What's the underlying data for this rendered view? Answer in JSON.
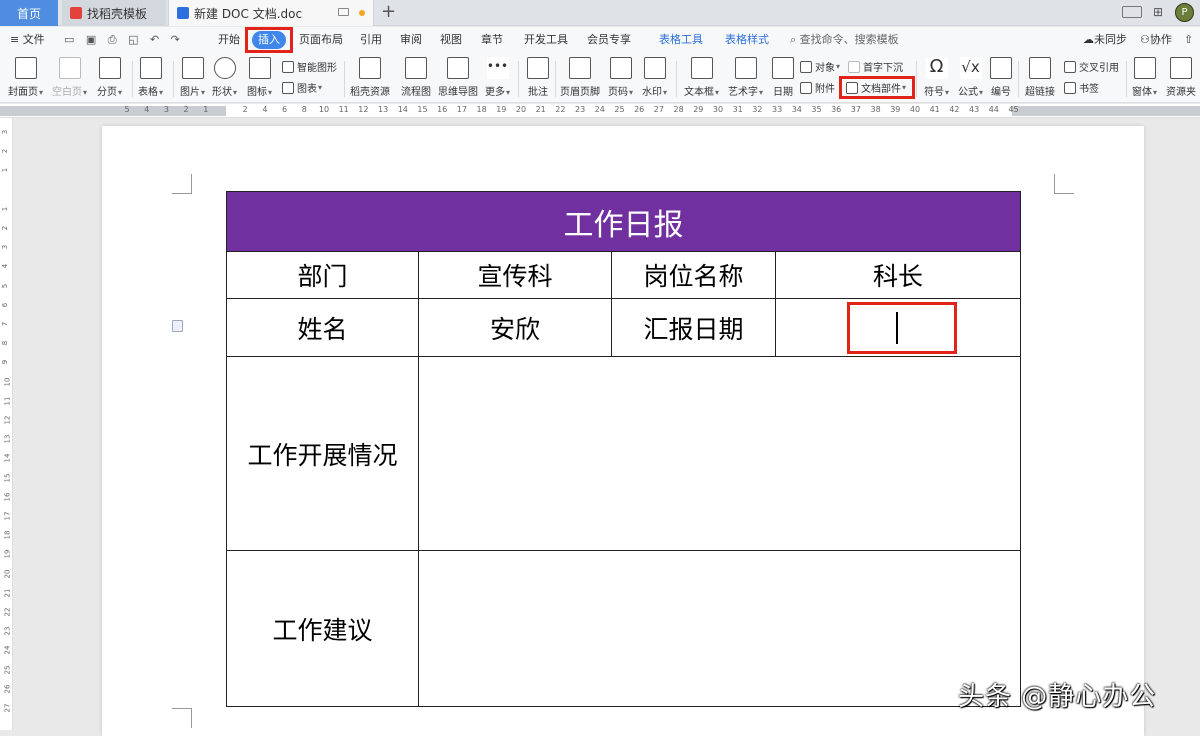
{
  "tabs": {
    "home": "首页",
    "template": "找稻壳模板",
    "document": "新建 DOC 文档.doc",
    "new_tab": "+"
  },
  "window_controls": {
    "layout": "□",
    "grid": "⊞",
    "avatar": "P"
  },
  "menu": {
    "file": "文件",
    "start": "开始",
    "insert": "插入",
    "page_layout": "页面布局",
    "references": "引用",
    "review": "审阅",
    "view": "视图",
    "chapter": "章节",
    "dev_tools": "开发工具",
    "member": "会员专享",
    "table_tools": "表格工具",
    "table_style": "表格样式",
    "search_placeholder": "查找命令、搜索模板",
    "not_synced": "未同步",
    "collaborate": "协作"
  },
  "ribbon": {
    "cover": "封面页",
    "blank_page": "空白页",
    "page_break": "分页",
    "table": "表格",
    "picture": "图片",
    "shape": "形状",
    "icon": "图标",
    "smart_shape": "智能图形",
    "chart": "图表",
    "docer_resources": "稻壳资源",
    "flowchart": "流程图",
    "mindmap": "思维导图",
    "more": "更多",
    "comment": "批注",
    "header_footer": "页眉页脚",
    "page_number": "页码",
    "watermark": "水印",
    "textbox": "文本框",
    "wordart": "艺术字",
    "date": "日期",
    "object": "对象",
    "drop_cap": "首字下沉",
    "attachment": "附件",
    "doc_parts": "文档部件",
    "symbol": "符号",
    "formula": "公式",
    "numbering": "编号",
    "hyperlink": "超链接",
    "cross_ref": "交叉引用",
    "bookmark": "书签",
    "window": "窗体",
    "resource_folder": "资源夹"
  },
  "ruler": {
    "h_numbers": [
      "5",
      "4",
      "3",
      "2",
      "1",
      "",
      "2",
      "4",
      "6",
      "8",
      "10",
      "11",
      "12",
      "13",
      "14",
      "15",
      "16",
      "17",
      "18",
      "19",
      "20",
      "21",
      "22",
      "23",
      "24",
      "25",
      "26",
      "27",
      "28",
      "29",
      "30",
      "31",
      "32",
      "33",
      "34",
      "35",
      "36",
      "37",
      "38",
      "39",
      "40",
      "41",
      "42",
      "43",
      "44",
      "45"
    ],
    "v_numbers": [
      "3",
      "2",
      "1",
      "",
      "1",
      "2",
      "3",
      "4",
      "5",
      "6",
      "7",
      "8",
      "9",
      "10",
      "11",
      "12",
      "13",
      "14",
      "15",
      "16",
      "17",
      "18",
      "19",
      "20",
      "21",
      "22",
      "23",
      "24",
      "25",
      "26",
      "27"
    ]
  },
  "table": {
    "title": "工作日报",
    "dept_label": "部门",
    "dept_value": "宣传科",
    "position_label": "岗位名称",
    "position_value": "科长",
    "name_label": "姓名",
    "name_value": "安欣",
    "report_date_label": "汇报日期",
    "report_date_value": "",
    "progress_label": "工作开展情况",
    "progress_value": "",
    "suggestion_label": "工作建议",
    "suggestion_value": ""
  },
  "watermark": "头条 @静心办公",
  "colors": {
    "title_bg": "#7030a0",
    "highlight": "#e2231a",
    "accent": "#3e86ea"
  }
}
